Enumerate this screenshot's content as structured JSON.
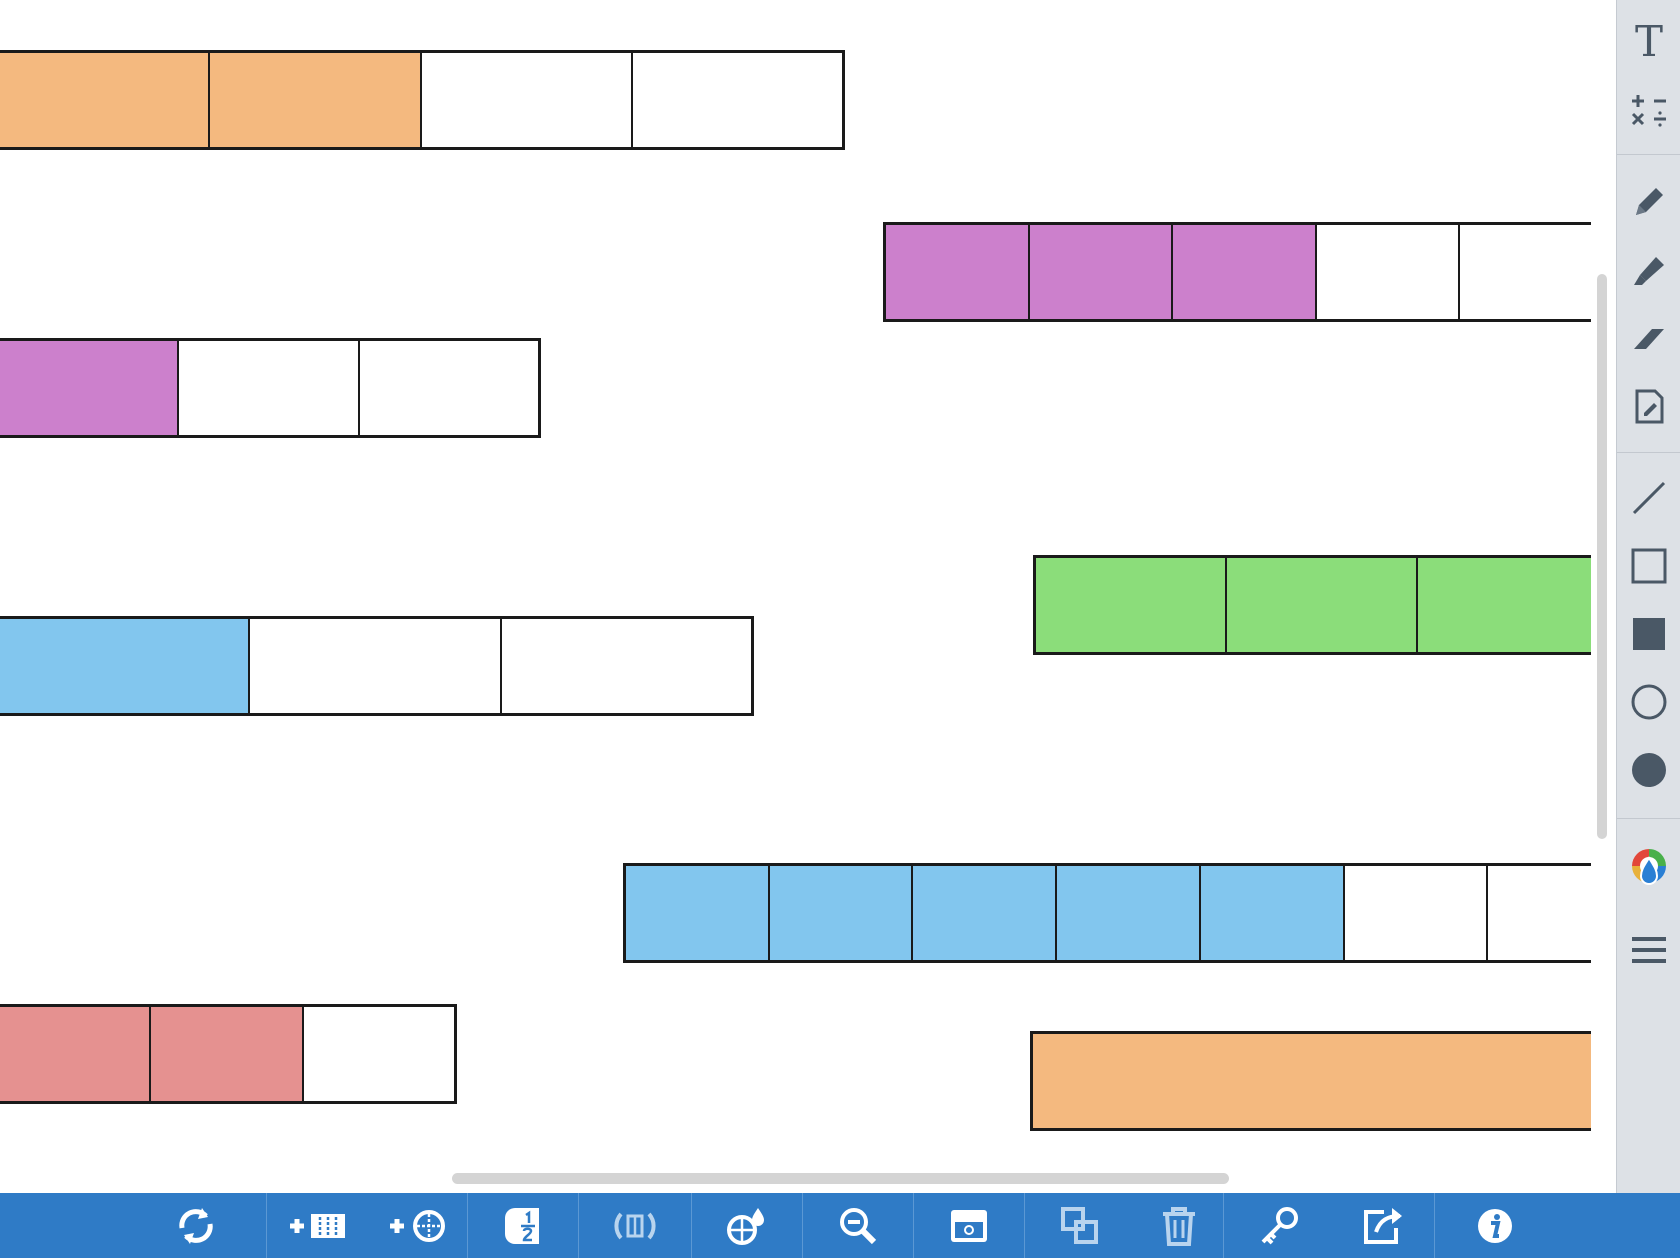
{
  "workspace": {
    "bars": [
      {
        "segments": [
          "#f4b97f",
          "#f4b97f",
          "#ffffff",
          "#ffffff"
        ]
      },
      {
        "segments": [
          "#cc80cc",
          "#cc80cc",
          "#cc80cc",
          "#ffffff",
          "#ffffff"
        ]
      },
      {
        "segments": [
          "#cc80cc",
          "#ffffff",
          "#ffffff"
        ]
      },
      {
        "segments": [
          "#8bdd7a",
          "#8bdd7a",
          "#8bdd7a"
        ]
      },
      {
        "segments": [
          "#82c6ee",
          "#ffffff",
          "#ffffff"
        ]
      },
      {
        "segments": [
          "#82c6ee",
          "#82c6ee",
          "#82c6ee",
          "#82c6ee",
          "#82c6ee",
          "#ffffff",
          "#ffffff"
        ]
      },
      {
        "segments": [
          "#e59190",
          "#e59190",
          "#ffffff"
        ]
      },
      {
        "segments": [
          "#f4b97f"
        ]
      }
    ]
  },
  "colors": {
    "orange": "#f4b97f",
    "purple": "#cc80cc",
    "green": "#8bdd7a",
    "blue": "#82c6ee",
    "red": "#e59190",
    "toolbar": "#2f7bc6",
    "sidebar": "#dde1e6",
    "sidebar_icon": "#4a5866"
  },
  "sidebar": {
    "text_tool": "T",
    "tools": [
      "text-icon",
      "math-symbols-icon",
      "pen-icon",
      "highlighter-icon",
      "eraser-icon",
      "note-icon",
      "line-icon",
      "rectangle-outline-icon",
      "rectangle-filled-icon",
      "circle-outline-icon",
      "circle-filled-icon",
      "color-palette-icon",
      "menu-icon"
    ]
  },
  "toolbar": {
    "items": [
      "reset-icon",
      "add-bar-icon",
      "add-circle-icon",
      "fraction-label-icon",
      "flip-icon",
      "fill-color-icon",
      "zoom-out-icon",
      "hide-show-icon",
      "duplicate-icon",
      "trash-icon",
      "key-icon",
      "share-icon",
      "info-icon"
    ]
  }
}
